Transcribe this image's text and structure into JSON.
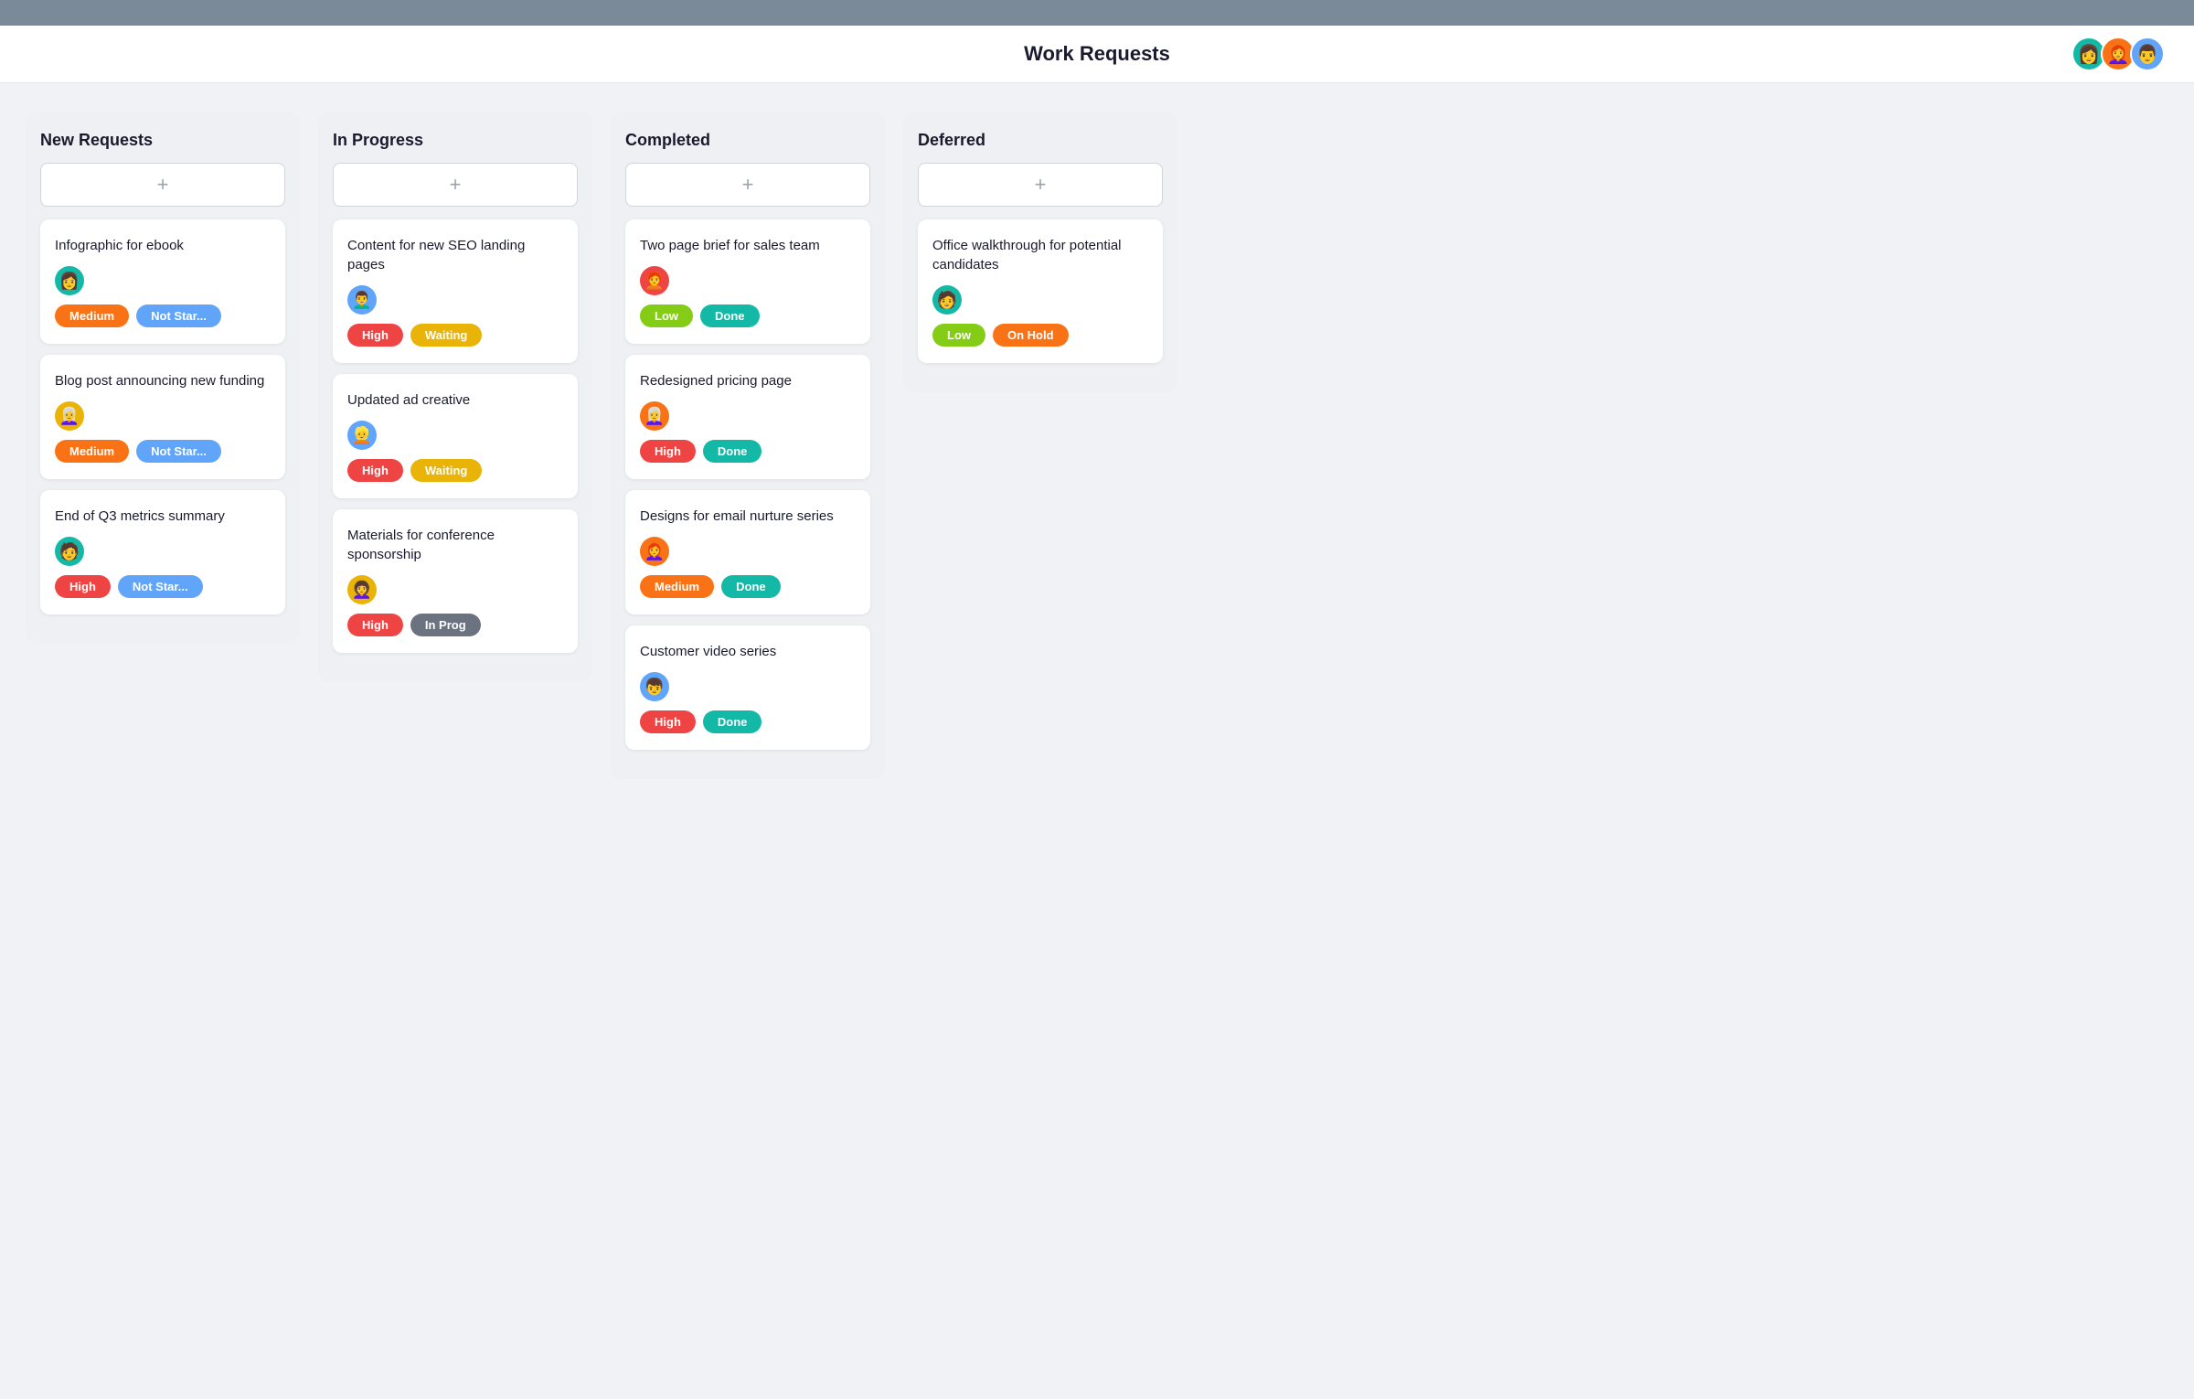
{
  "header": {
    "title": "Work Requests",
    "avatars": [
      {
        "id": "av1",
        "emoji": "👩",
        "color": "#14b8a6"
      },
      {
        "id": "av2",
        "emoji": "👩‍🦰",
        "color": "#f97316"
      },
      {
        "id": "av3",
        "emoji": "👨",
        "color": "#60a5fa"
      }
    ]
  },
  "columns": [
    {
      "id": "new-requests",
      "label": "New Requests",
      "cards": [
        {
          "id": "card-1",
          "title": "Infographic for ebook",
          "avatar_color": "#14b8a6",
          "avatar_emoji": "👩",
          "priority": "Medium",
          "priority_class": "badge-medium",
          "status": "Not Star...",
          "status_class": "badge-not-started"
        },
        {
          "id": "card-2",
          "title": "Blog post announcing new funding",
          "avatar_color": "#eab308",
          "avatar_emoji": "👩‍🦳",
          "priority": "Medium",
          "priority_class": "badge-medium",
          "status": "Not Star...",
          "status_class": "badge-not-started"
        },
        {
          "id": "card-3",
          "title": "End of Q3 metrics summary",
          "avatar_color": "#14b8a6",
          "avatar_emoji": "🧑",
          "priority": "High",
          "priority_class": "badge-high",
          "status": "Not Star...",
          "status_class": "badge-not-started"
        }
      ]
    },
    {
      "id": "in-progress",
      "label": "In Progress",
      "cards": [
        {
          "id": "card-4",
          "title": "Content for new SEO landing pages",
          "avatar_color": "#60a5fa",
          "avatar_emoji": "👨‍🦱",
          "priority": "High",
          "priority_class": "badge-high",
          "status": "Waiting",
          "status_class": "badge-waiting"
        },
        {
          "id": "card-5",
          "title": "Updated ad creative",
          "avatar_color": "#60a5fa",
          "avatar_emoji": "👱",
          "priority": "High",
          "priority_class": "badge-high",
          "status": "Waiting",
          "status_class": "badge-waiting"
        },
        {
          "id": "card-6",
          "title": "Materials for conference sponsorship",
          "avatar_color": "#eab308",
          "avatar_emoji": "👩‍🦱",
          "priority": "High",
          "priority_class": "badge-high",
          "status": "In Prog",
          "status_class": "badge-in-progress"
        }
      ]
    },
    {
      "id": "completed",
      "label": "Completed",
      "cards": [
        {
          "id": "card-7",
          "title": "Two page brief for sales team",
          "avatar_color": "#ef4444",
          "avatar_emoji": "🧑‍🦰",
          "priority": "Low",
          "priority_class": "badge-low",
          "status": "Done",
          "status_class": "badge-done"
        },
        {
          "id": "card-8",
          "title": "Redesigned pricing page",
          "avatar_color": "#f97316",
          "avatar_emoji": "👩‍🦳",
          "priority": "High",
          "priority_class": "badge-high",
          "status": "Done",
          "status_class": "badge-done"
        },
        {
          "id": "card-9",
          "title": "Designs for email nurture series",
          "avatar_color": "#f97316",
          "avatar_emoji": "👩‍🦰",
          "priority": "Medium",
          "priority_class": "badge-medium",
          "status": "Done",
          "status_class": "badge-done"
        },
        {
          "id": "card-10",
          "title": "Customer video series",
          "avatar_color": "#60a5fa",
          "avatar_emoji": "👦",
          "priority": "High",
          "priority_class": "badge-high",
          "status": "Done",
          "status_class": "badge-done"
        }
      ]
    },
    {
      "id": "deferred",
      "label": "Deferred",
      "cards": [
        {
          "id": "card-11",
          "title": "Office walkthrough for potential candidates",
          "avatar_color": "#14b8a6",
          "avatar_emoji": "🧑",
          "priority": "Low",
          "priority_class": "badge-low",
          "status": "On Hold",
          "status_class": "badge-on-hold"
        }
      ]
    }
  ],
  "add_button_label": "+"
}
